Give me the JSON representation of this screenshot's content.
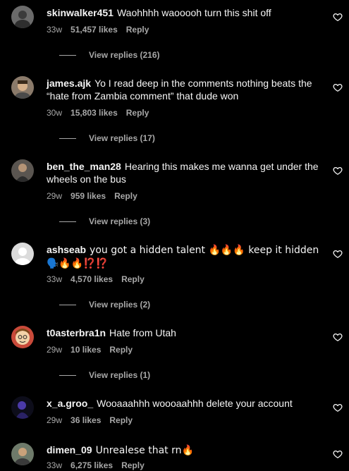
{
  "comments": [
    {
      "username": "skinwalker451",
      "text": "Waohhhh waooooh turn this shit off",
      "age": "33w",
      "likes": "51,457 likes",
      "reply": "Reply",
      "view_replies": "View replies (216)"
    },
    {
      "username": "james.ajk",
      "text": "Yo I read deep in the comments nothing beats the “hate from Zambia comment” that dude won",
      "age": "30w",
      "likes": "15,803 likes",
      "reply": "Reply",
      "view_replies": "View replies (17)"
    },
    {
      "username": "ben_the_man28",
      "text": "Hearing this makes me wanna get under the wheels on the bus",
      "age": "29w",
      "likes": "959 likes",
      "reply": "Reply",
      "view_replies": "View replies (3)"
    },
    {
      "username": "ashseab",
      "text": "you got a hidden talent 🔥🔥🔥 keep it hidden 🗣️🔥🔥⁉️⁉️",
      "age": "33w",
      "likes": "4,570 likes",
      "reply": "Reply",
      "view_replies": "View replies (2)"
    },
    {
      "username": "t0asterbra1n",
      "text": "Hate from Utah",
      "age": "29w",
      "likes": "10 likes",
      "reply": "Reply",
      "view_replies": "View replies (1)"
    },
    {
      "username": "x_a.groo_",
      "text": "Wooaaahhh woooaahhh delete your account",
      "age": "29w",
      "likes": "36 likes",
      "reply": "Reply",
      "view_replies": ""
    },
    {
      "username": "dimen_09",
      "text": "Unrealese that rn🔥",
      "age": "33w",
      "likes": "6,275 likes",
      "reply": "Reply",
      "view_replies": ""
    }
  ],
  "icons": {
    "heart": "heart-outline-icon",
    "replies_line": "replies-divider-line"
  },
  "colors": {
    "background": "#000000",
    "text": "#f5f5f5",
    "secondary": "#a8a8a8"
  }
}
